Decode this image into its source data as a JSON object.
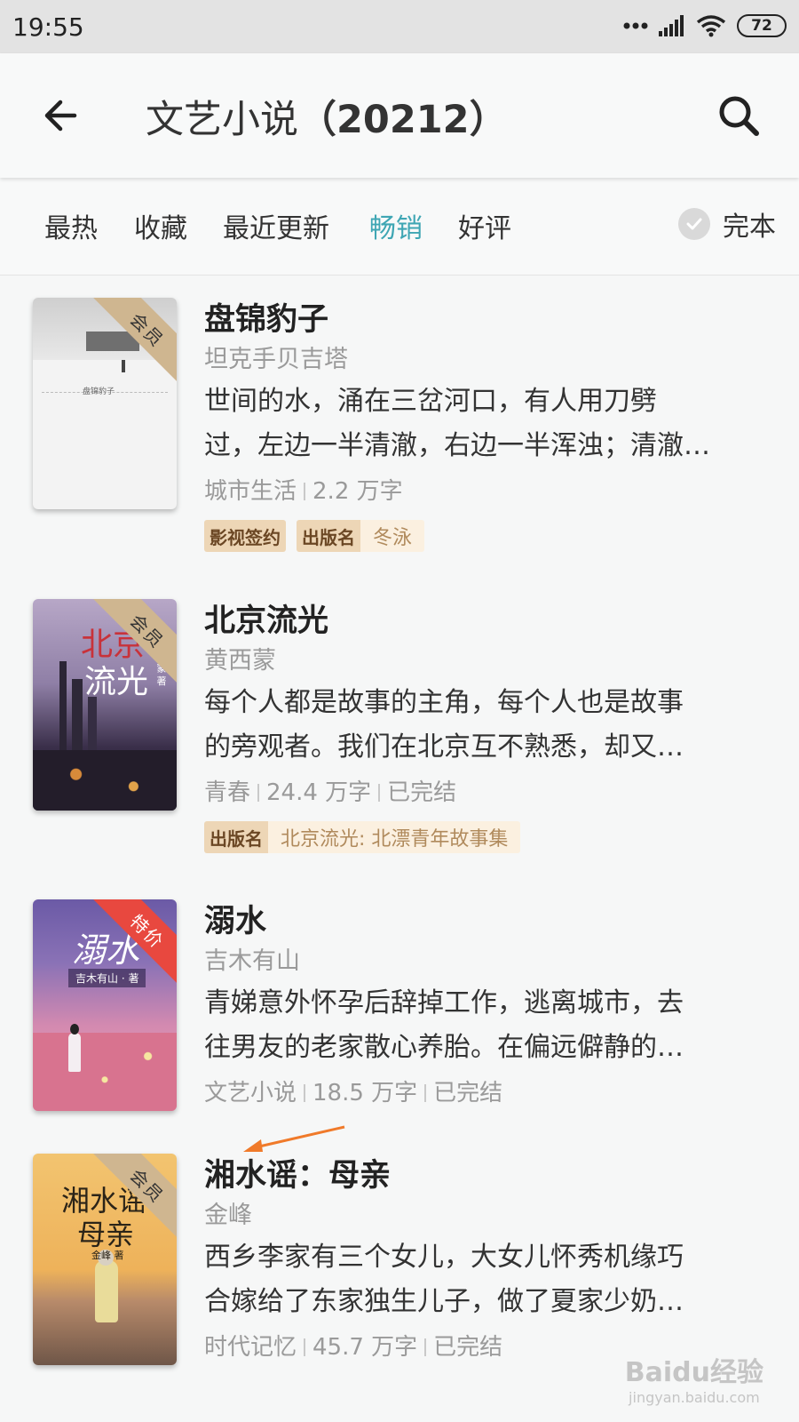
{
  "status_bar": {
    "time": "19:55",
    "battery": "72"
  },
  "app_bar": {
    "title": "文艺小说",
    "count": "（20212）"
  },
  "tabs": [
    {
      "label": "最热"
    },
    {
      "label": "收藏"
    },
    {
      "label": "最近更新"
    },
    {
      "label": "畅销"
    },
    {
      "label": "好评"
    }
  ],
  "active_tab": "畅销",
  "filter": {
    "label": "完本"
  },
  "books": [
    {
      "title": "盘锦豹子",
      "author": "坦克手贝吉塔",
      "desc_line1": "世间的水，涌在三岔河口，有人用刀劈",
      "desc_line2": "过，左边一半清澈，右边一半浑浊；清澈…",
      "category": "城市生活",
      "words": "2.2 万字",
      "badge": "会员",
      "cover_text": "盘锦豹子",
      "tags": [
        {
          "key": "影视签约",
          "value": ""
        },
        {
          "key": "出版名",
          "value": "冬泳"
        }
      ]
    },
    {
      "title": "北京流光",
      "author": "黄西蒙",
      "desc_line1": "每个人都是故事的主角，每个人也是故事",
      "desc_line2": "的旁观者。我们在北京互不熟悉，却又…",
      "category": "青春",
      "words": "24.4 万字",
      "status": "已完结",
      "badge": "会员",
      "cover_title1": "北京",
      "cover_title2": "流光",
      "cover_author": "黄西蒙 著",
      "tags": [
        {
          "key": "出版名",
          "value": "北京流光: 北漂青年故事集"
        }
      ]
    },
    {
      "title": "溺水",
      "author": "吉木有山",
      "desc_line1": "青娣意外怀孕后辞掉工作，逃离城市，去",
      "desc_line2": "往男友的老家散心养胎。在偏远僻静的…",
      "category": "文艺小说",
      "words": "18.5 万字",
      "status": "已完结",
      "badge": "特价",
      "cover_title": "溺水",
      "cover_author": "吉木有山 · 著"
    },
    {
      "title": "湘水谣：母亲",
      "author": "金峰",
      "desc_line1": "西乡李家有三个女儿，大女儿怀秀机缘巧",
      "desc_line2": "合嫁给了东家独生儿子，做了夏家少奶…",
      "category": "时代记忆",
      "words": "45.7 万字",
      "status": "已完结",
      "badge": "会员",
      "cover_title1": "湘水谣",
      "cover_title2": "母亲",
      "cover_author": "金峰 著"
    }
  ],
  "watermark": {
    "line1": "Baidu经验",
    "line2": "jingyan.baidu.com"
  },
  "colors": {
    "accent": "#3fa6b4",
    "member_badge": "#cfb690",
    "sale_badge": "#e8483f",
    "annotation_arrow": "#f07a2a"
  }
}
